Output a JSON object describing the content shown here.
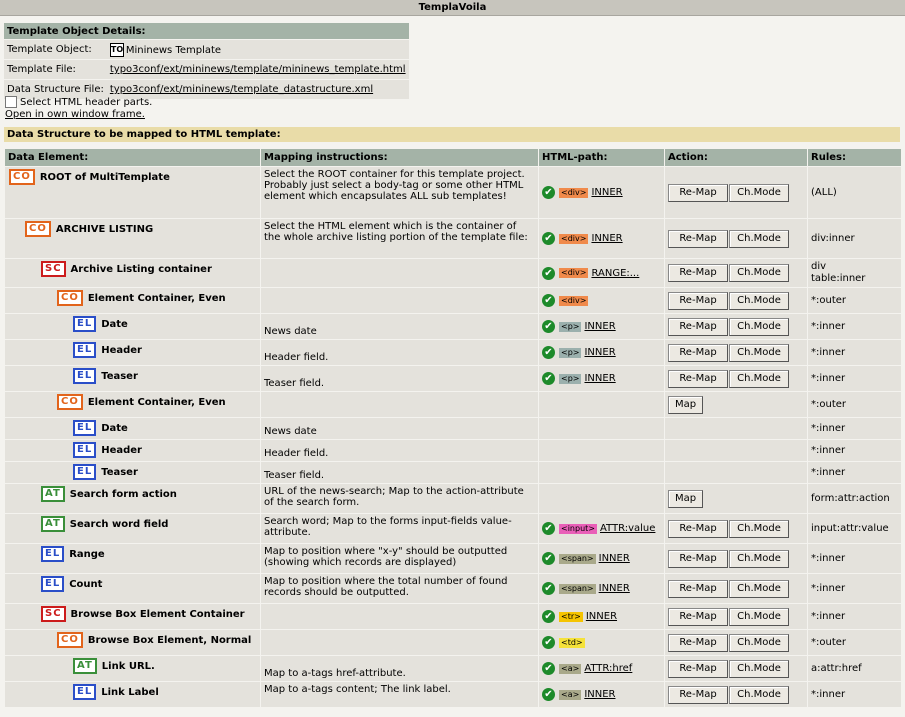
{
  "window": {
    "title": "TemplaVoila"
  },
  "details": {
    "heading": "Template Object Details:",
    "rows": [
      {
        "label": "Template Object:",
        "icon": "TO",
        "value": "Mininews Template",
        "link": false
      },
      {
        "label": "Template File:",
        "value": "typo3conf/ext/mininews/template/mininews_template.html",
        "link": true
      },
      {
        "label": "Data Structure File:",
        "value": "typo3conf/ext/mininews/template_datastructure.xml",
        "link": true
      }
    ],
    "select_header_label": "Select HTML header parts.",
    "open_window_link": "Open in own window frame."
  },
  "mapping": {
    "heading": "Data Structure to be mapped to HTML template:",
    "columns": [
      "Data Element:",
      "Mapping instructions:",
      "HTML-path:",
      "Action:",
      "Rules:"
    ],
    "rows": [
      {
        "indent": 0,
        "type": "CO",
        "name": "ROOT of MultiTemplate",
        "instr": "Select the ROOT container for this template project. Probably just select a body-tag or some other HTML element which encapsulates ALL sub templates!",
        "mapped": true,
        "tag": "<div>",
        "tag_color": "#f08a4b",
        "path": "INNER",
        "actions": [
          "Re-Map",
          "Ch.Mode"
        ],
        "rules": "(ALL)"
      },
      {
        "indent": 1,
        "type": "CO",
        "name": "ARCHIVE LISTING",
        "instr": "Select the HTML element which is the container of the whole archive listing portion of the template file:",
        "mapped": true,
        "tag": "<div>",
        "tag_color": "#f08a4b",
        "path": "INNER",
        "actions": [
          "Re-Map",
          "Ch.Mode"
        ],
        "rules": "div:inner"
      },
      {
        "indent": 2,
        "type": "SC",
        "name": "Archive Listing container",
        "instr": "",
        "mapped": true,
        "tag": "<div>",
        "tag_color": "#f08a4b",
        "path": "RANGE:...",
        "actions": [
          "Re-Map",
          "Ch.Mode"
        ],
        "rules": "div\ntable:inner"
      },
      {
        "indent": 3,
        "type": "CO",
        "name": "Element Container, Even",
        "instr": "",
        "mapped": true,
        "tag": "<div>",
        "tag_color": "#f08a4b",
        "path": "",
        "actions": [
          "Re-Map",
          "Ch.Mode"
        ],
        "rules": "*:outer"
      },
      {
        "indent": 4,
        "type": "EL",
        "name": "Date",
        "instr": "News date",
        "mapped": true,
        "tag": "<p>",
        "tag_color": "#9bb0ad",
        "path": "INNER",
        "actions": [
          "Re-Map",
          "Ch.Mode"
        ],
        "rules": "*:inner"
      },
      {
        "indent": 4,
        "type": "EL",
        "name": "Header",
        "instr": "Header field.",
        "mapped": true,
        "tag": "<p>",
        "tag_color": "#9bb0ad",
        "path": "INNER",
        "actions": [
          "Re-Map",
          "Ch.Mode"
        ],
        "rules": "*:inner"
      },
      {
        "indent": 4,
        "type": "EL",
        "name": "Teaser",
        "instr": "Teaser field.",
        "mapped": true,
        "tag": "<p>",
        "tag_color": "#9bb0ad",
        "path": "INNER",
        "actions": [
          "Re-Map",
          "Ch.Mode"
        ],
        "rules": "*:inner"
      },
      {
        "indent": 3,
        "type": "CO",
        "name": "Element Container, Even",
        "instr": "",
        "mapped": false,
        "actions": [
          "Map"
        ],
        "rules": "*:outer"
      },
      {
        "indent": 4,
        "type": "EL",
        "name": "Date",
        "instr": "News date",
        "mapped": false,
        "actions": [],
        "rules": "*:inner"
      },
      {
        "indent": 4,
        "type": "EL",
        "name": "Header",
        "instr": "Header field.",
        "mapped": false,
        "actions": [],
        "rules": "*:inner"
      },
      {
        "indent": 4,
        "type": "EL",
        "name": "Teaser",
        "instr": "Teaser field.",
        "mapped": false,
        "actions": [],
        "rules": "*:inner"
      },
      {
        "indent": 2,
        "type": "AT",
        "name": "Search form action",
        "instr": "URL of the news-search; Map to the action-attribute of the search form.",
        "mapped": false,
        "actions": [
          "Map"
        ],
        "rules": "form:attr:action"
      },
      {
        "indent": 2,
        "type": "AT",
        "name": "Search word field",
        "instr": "Search word; Map to the forms input-fields value-attribute.",
        "mapped": true,
        "tag": "<input>",
        "tag_color": "#e95fb8",
        "path": "ATTR:value",
        "actions": [
          "Re-Map",
          "Ch.Mode"
        ],
        "rules": "input:attr:value"
      },
      {
        "indent": 2,
        "type": "EL",
        "name": "Range",
        "instr": "Map to position where \"x-y\" should be outputted (showing which records are displayed)",
        "mapped": true,
        "tag": "<span>",
        "tag_color": "#a9a98a",
        "path": "INNER",
        "actions": [
          "Re-Map",
          "Ch.Mode"
        ],
        "rules": "*:inner"
      },
      {
        "indent": 2,
        "type": "EL",
        "name": "Count",
        "instr": "Map to position where the total number of found records should be outputted.",
        "mapped": true,
        "tag": "<span>",
        "tag_color": "#a9a98a",
        "path": "INNER",
        "actions": [
          "Re-Map",
          "Ch.Mode"
        ],
        "rules": "*:inner"
      },
      {
        "indent": 2,
        "type": "SC",
        "name": "Browse Box Element Container",
        "instr": "",
        "mapped": true,
        "tag": "<tr>",
        "tag_color": "#f5c400",
        "path": "INNER",
        "actions": [
          "Re-Map",
          "Ch.Mode"
        ],
        "rules": "*:inner"
      },
      {
        "indent": 3,
        "type": "CO",
        "name": "Browse Box Element, Normal",
        "instr": "",
        "mapped": true,
        "tag": "<td>",
        "tag_color": "#f5e23a",
        "path": "",
        "actions": [
          "Re-Map",
          "Ch.Mode"
        ],
        "rules": "*:outer"
      },
      {
        "indent": 4,
        "type": "AT",
        "name": "Link URL.",
        "instr": "Map to a-tags href-attribute.",
        "mapped": true,
        "tag": "<a>",
        "tag_color": "#a9a98a",
        "path": "ATTR:href",
        "actions": [
          "Re-Map",
          "Ch.Mode"
        ],
        "rules": "a:attr:href"
      },
      {
        "indent": 4,
        "type": "EL",
        "name": "Link Label",
        "instr": "Map to a-tags content; The link label.",
        "mapped": true,
        "tag": "<a>",
        "tag_color": "#a9a98a",
        "path": "INNER",
        "actions": [
          "Re-Map",
          "Ch.Mode"
        ],
        "rules": "*:inner"
      }
    ]
  }
}
